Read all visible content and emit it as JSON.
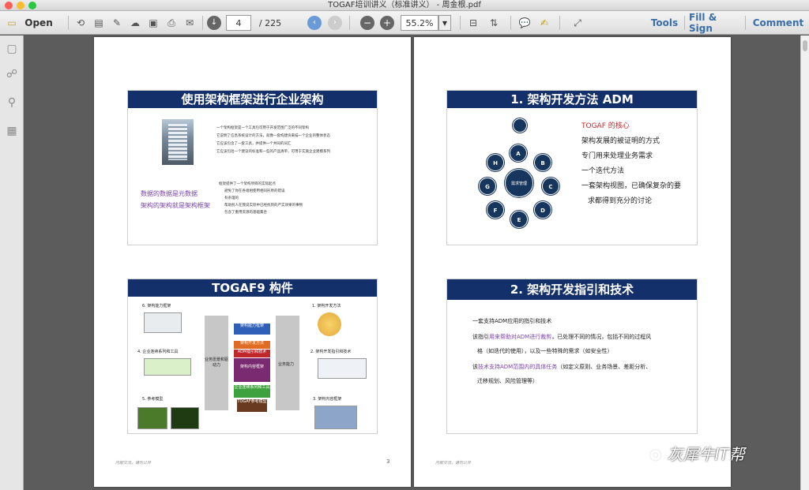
{
  "window": {
    "title": "TOGAF培训讲义（标准讲义） - 周金根.pdf"
  },
  "toolbar": {
    "open_label": "Open",
    "page_current": "4",
    "page_total": "/ 225",
    "zoom": "55.2%",
    "tools_label": "Tools",
    "fill_sign_label": "Fill & Sign",
    "comment_label": "Comment"
  },
  "left_page": {
    "slide1": {
      "title": "使用架构框架进行企业架构",
      "bullets_top": [
        "一个架构框架是一个工具包可用于开发范围广泛的不同架构",
        "它说明了信息系统设计的方法，就像一套构建块来描一个企业的整体状态",
        "它应该包含了一套工具，并提供一个共同的词汇",
        "它应该包括一个建议的标准和一些的产品清单，可用于实施企业建模系列"
      ],
      "side_line1": "数据的数据是元数据",
      "side_line2": "架构的架构就是架构框架",
      "bullets_bottom_head": "框架提供了一个架构项目的实际起点",
      "bullets_bottom": [
        "避免了你在各组相使用相同形原的错误",
        "有条理的",
        "帮助别人在我说实际中已经找到的严实效果的事物",
        "包含了重用资源的基础集合"
      ]
    },
    "slide2": {
      "title": "TOGAF9 构件",
      "left_labels": [
        "6. 架构能力框架",
        "4. 企业连续系列和工具",
        "5. 参考模型"
      ],
      "right_labels": [
        "1. 架构开发方法",
        "2. 架构开发指引和技术",
        "3. 架构内容框架"
      ],
      "center_left": "业务愿景和驱动力",
      "center_right": "业务能力",
      "stack": [
        "架构能力框架",
        "架构开发方法",
        "ADM指引和技术",
        "架构内容框架",
        "企业连续系列和工具",
        "TOGAF参考模型"
      ]
    },
    "footer_left": "内部交流，请勿公开",
    "page_number": "3"
  },
  "right_page": {
    "slide1": {
      "title": "1. 架构开发方法 ADM",
      "bullets": [
        "TOGAF 的核心",
        "架构发展的被证明的方式",
        "专门用来处理业务需求",
        "一个迭代方法",
        "一套架构视图，已确保复杂的要",
        "求都得到充分的讨论"
      ],
      "center": "需求管理",
      "nodes": [
        "A",
        "B",
        "C",
        "D",
        "E",
        "F",
        "G",
        "H"
      ]
    },
    "slide2": {
      "title": "2. 架构开发指引和技术",
      "line1": "一套支持ADM应用的指引和技术",
      "line2a": "该指引",
      "line2b": "用来帮助对ADM进行裁剪",
      "line2c": "，已处理不同的情况，包括不同的过程风",
      "line3": "格（如迭代的使用），以及一些特殊的需求（如安全性）",
      "line4a": "该",
      "line4b": "技术支持ADM范围内的具体任务",
      "line4c": "（如定义原则、业务场景、差距分析、",
      "line5": "迁移规划、风险管理等）"
    },
    "footer_left": "内部交流，请勿公开"
  },
  "watermark": "灰犀牛IT帮"
}
